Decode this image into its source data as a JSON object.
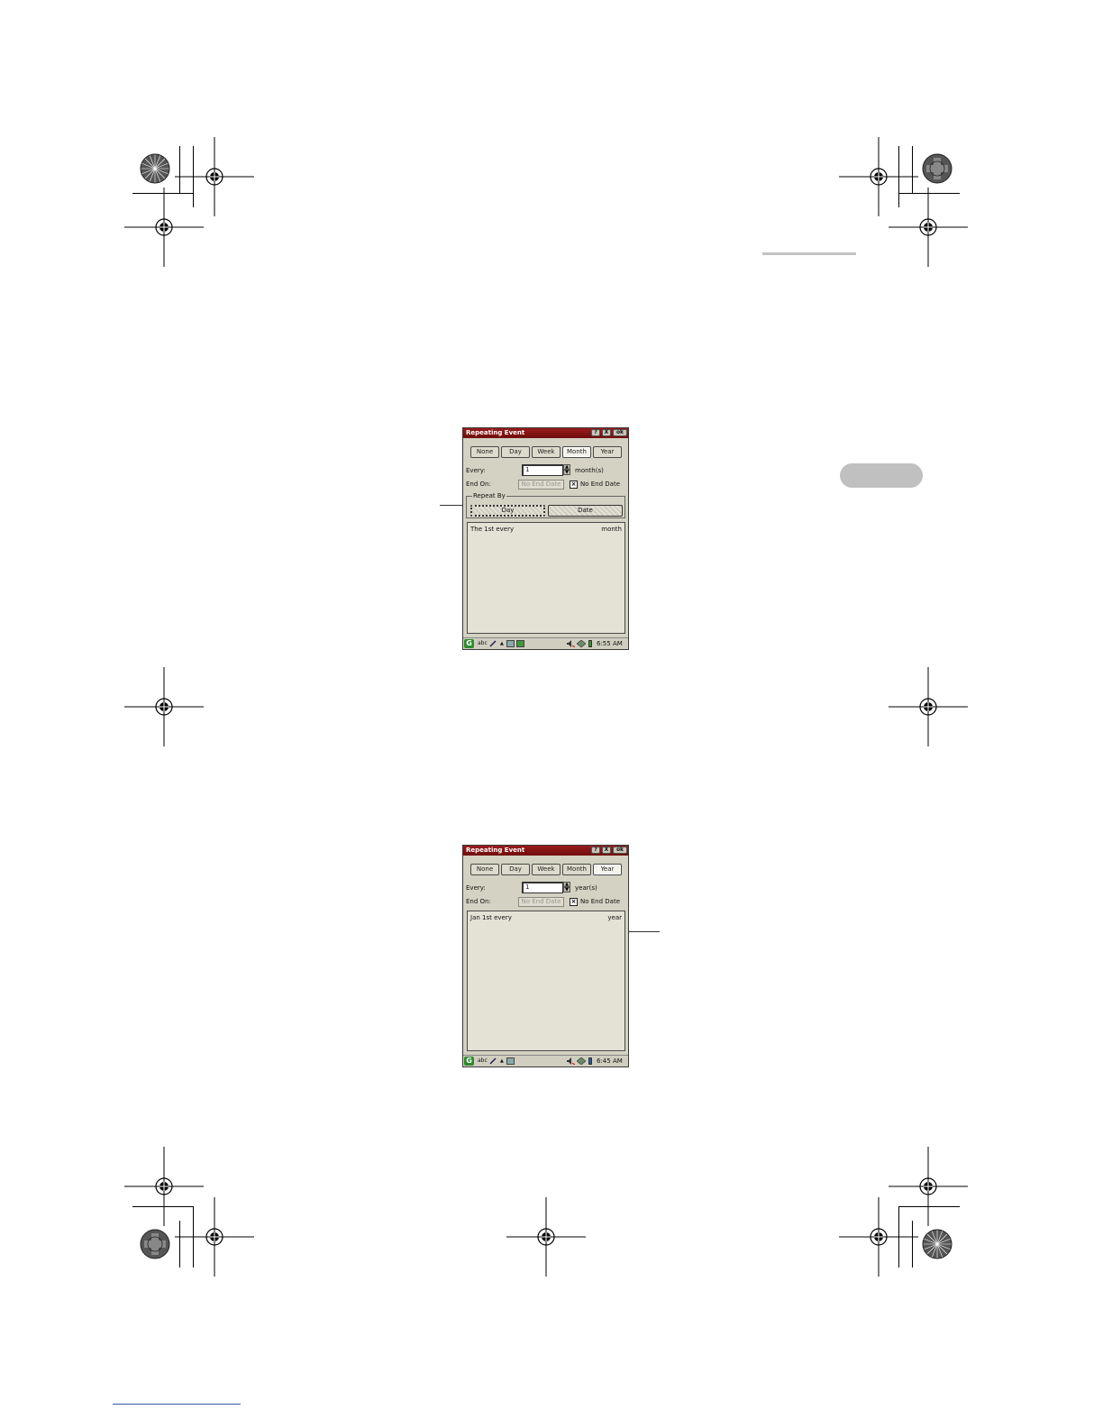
{
  "screen_month": {
    "title": "Repeating Event",
    "titlebar_buttons": {
      "help": "?",
      "close": "X",
      "ok": "ok"
    },
    "tabs": [
      "None",
      "Day",
      "Week",
      "Month",
      "Year"
    ],
    "selected_tab": "Month",
    "every_label": "Every:",
    "every_value": "1",
    "every_unit": "month(s)",
    "end_on_label": "End On:",
    "end_date_button": "No End Date",
    "no_end_checkbox": "No End Date",
    "repeat_by_label": "Repeat By",
    "repeat_by_day": "Day",
    "repeat_by_date": "Date",
    "list_left": "The 1st every",
    "list_right": "month",
    "taskbar_input": "abc",
    "time": "6:55 AM"
  },
  "screen_year": {
    "title": "Repeating Event",
    "titlebar_buttons": {
      "help": "?",
      "close": "X",
      "ok": "ok"
    },
    "tabs": [
      "None",
      "Day",
      "Week",
      "Month",
      "Year"
    ],
    "selected_tab": "Year",
    "every_label": "Every:",
    "every_value": "1",
    "every_unit": "year(s)",
    "end_on_label": "End On:",
    "end_date_button": "No End Date",
    "no_end_checkbox": "No End Date",
    "list_left": "Jan 1st every",
    "list_right": "year",
    "taskbar_input": "abc",
    "time": "6:45 AM"
  },
  "colors": {
    "titlebar": "#7e1414",
    "screen_bg": "#d4d2c2",
    "tab_indicator": "#c0c0c0"
  }
}
